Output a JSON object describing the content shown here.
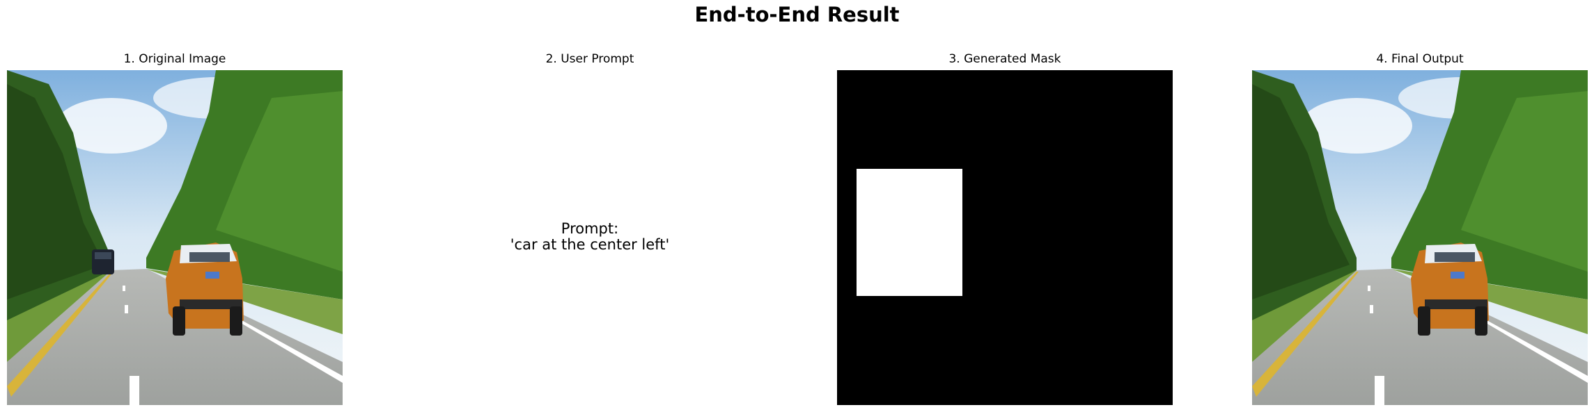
{
  "figure": {
    "title": "End-to-End Result"
  },
  "panels": [
    {
      "title": "1. Original Image",
      "content": "road scene photo: orange hatchback car on highway, dark SUV ahead, trees on both sides"
    },
    {
      "title": "2. User Prompt",
      "prompt_text": "Prompt:\n'car at the center left'"
    },
    {
      "title": "3. Generated Mask",
      "mask_colors": {
        "background": "#000000",
        "region": "#ffffff"
      }
    },
    {
      "title": "4. Final Output",
      "content": "road scene photo (same as original)"
    }
  ]
}
